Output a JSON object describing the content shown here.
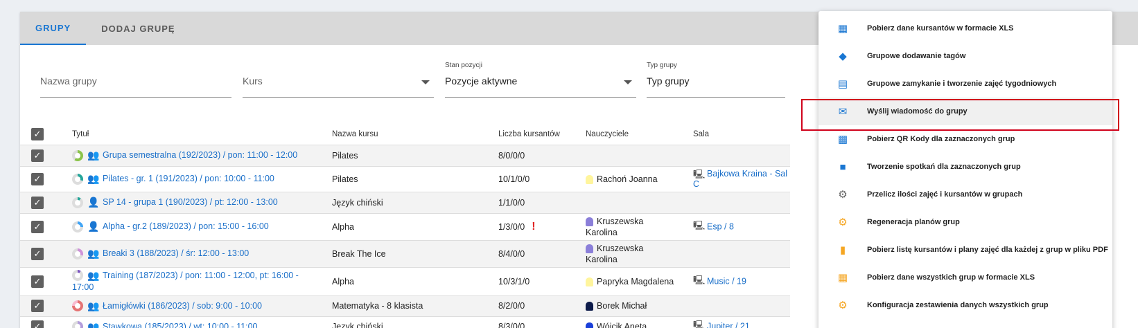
{
  "tabs": [
    {
      "label": "GRUPY"
    },
    {
      "label": "DODAJ GRUPĘ"
    }
  ],
  "filters": {
    "group_name": {
      "placeholder": "Nazwa grupy"
    },
    "course": {
      "placeholder": "Kurs"
    },
    "position_state": {
      "label": "Stan pozycji",
      "value": "Pozycje aktywne"
    },
    "group_type": {
      "label": "Typ grupy",
      "value": "Typ grupy"
    }
  },
  "columns": {
    "title": "Tytuł",
    "course": "Nazwa kursu",
    "count": "Liczba kursantów",
    "teachers": "Nauczyciele",
    "room": "Sala"
  },
  "rows": [
    {
      "title": "Grupa semestralna (192/2023) / pon: 11:00 - 12:00",
      "course": "Pilates",
      "count": "8/0/0/0",
      "teacher": "",
      "room": "",
      "room2": "",
      "alert": ""
    },
    {
      "title": "Pilates - gr. 1 (191/2023) / pon: 10:00 - 11:00",
      "course": "Pilates",
      "count": "10/1/0/0",
      "teacher": "Rachoń Joanna",
      "room": "Bajkowa Kraina - Sal",
      "room2": "C",
      "alert": ""
    },
    {
      "title": "SP 14 - grupa 1 (190/2023) / pt: 12:00 - 13:00",
      "course": "Język chiński",
      "count": "1/1/0/0",
      "teacher": "",
      "room": "",
      "room2": "",
      "alert": ""
    },
    {
      "title": "Alpha - gr.2 (189/2023) / pon: 15:00 - 16:00",
      "course": "Alpha",
      "count": "1/3/0/0",
      "teacher": "Kruszewska",
      "teacher2": "Karolina",
      "room": "Esp / 8",
      "room2": "",
      "alert": "!"
    },
    {
      "title": "Breaki 3 (188/2023) / śr: 12:00 - 13:00",
      "course": "Break The Ice",
      "count": "8/4/0/0",
      "teacher": "Kruszewska",
      "teacher2": "Karolina",
      "room": "",
      "room2": "",
      "alert": ""
    },
    {
      "title": "Training (187/2023) / pon: 11:00 - 12:00, pt: 16:00 -",
      "title2": "17:00",
      "course": "Alpha",
      "count": "10/3/1/0",
      "teacher": "Papryka Magdalena",
      "room": "Music / 19",
      "room2": "",
      "alert": ""
    },
    {
      "title": "Łamigłówki (186/2023) / sob: 9:00 - 10:00",
      "course": "Matematyka - 8 klasista",
      "count": "8/2/0/0",
      "teacher": "Borek Michał",
      "room": "",
      "room2": "",
      "alert": ""
    },
    {
      "title": "Stawkowa (185/2023) / wt: 10:00 - 11:00",
      "course": "Język chiński",
      "count": "8/3/0/0",
      "teacher": "Wójcik Aneta",
      "room": "Jupiter / 21",
      "room2": "",
      "alert": ""
    }
  ],
  "menu": [
    {
      "label": "Pobierz dane kursantów w formacie XLS",
      "icon": "spreadsheet-icon",
      "color": "#1976d2"
    },
    {
      "label": "Grupowe dodawanie tagów",
      "icon": "tags-icon",
      "color": "#1976d2"
    },
    {
      "label": "Grupowe zamykanie i tworzenie zajęć tygodniowych",
      "icon": "calendar-icon",
      "color": "#1976d2"
    },
    {
      "label": "Wyślij wiadomość do grupy",
      "icon": "envelope-icon",
      "color": "#1976d2"
    },
    {
      "label": "Pobierz QR Kody dla zaznaczonych grup",
      "icon": "qr-code-icon",
      "color": "#1976d2"
    },
    {
      "label": "Tworzenie spotkań dla zaznaczonych grup",
      "icon": "video-camera-icon",
      "color": "#1976d2"
    },
    {
      "label": "Przelicz ilości zajęć i kursantów w grupach",
      "icon": "gears-icon",
      "color": "#666666"
    },
    {
      "label": "Regeneracja planów grup",
      "icon": "gears-icon",
      "color": "#f5a623"
    },
    {
      "label": "Pobierz listę kursantów i plany zajęć dla każdej z grup w pliku PDF",
      "icon": "pdf-icon",
      "color": "#f5a623"
    },
    {
      "label": "Pobierz dane wszystkich grup w formacie XLS",
      "icon": "spreadsheet-icon",
      "color": "#f5a623"
    },
    {
      "label": "Konfiguracja zestawienia danych wszystkich grup",
      "icon": "gear-icon",
      "color": "#f5a623"
    }
  ],
  "accent": "#1976d2",
  "highlight": "#d0021b"
}
